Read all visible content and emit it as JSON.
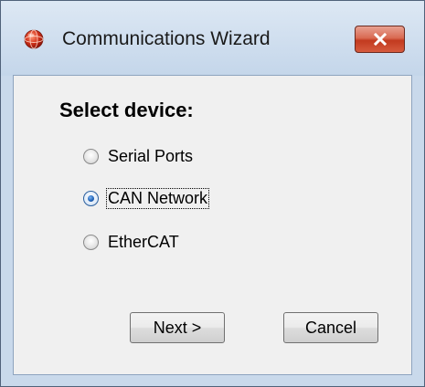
{
  "window": {
    "title": "Communications Wizard",
    "close_label": "close"
  },
  "icons": {
    "app": "app-globe-icon",
    "close": "close-icon"
  },
  "content": {
    "heading": "Select device:",
    "options": [
      {
        "label": "Serial Ports",
        "checked": false,
        "focused": false
      },
      {
        "label": "CAN Network",
        "checked": true,
        "focused": true
      },
      {
        "label": "EtherCAT",
        "checked": false,
        "focused": false
      }
    ],
    "next_label": "Next >",
    "cancel_label": "Cancel"
  },
  "colors": {
    "frame": "#c9d9eb",
    "client": "#f0f0f0",
    "close_button": "#c9452c",
    "radio_accent": "#1c5fb4"
  }
}
